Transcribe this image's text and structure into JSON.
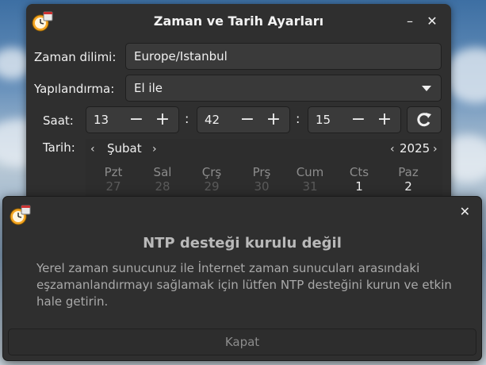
{
  "window": {
    "title": "Zaman ve Tarih Ayarları",
    "minimize_glyph": "–",
    "close_glyph": "✕"
  },
  "timezone": {
    "label": "Zaman dilimi:",
    "value": "Europe/Istanbul"
  },
  "config": {
    "label": "Yapılandırma:",
    "value": "El ile"
  },
  "time": {
    "label": "Saat:",
    "hour": "13",
    "minute": "42",
    "second": "15",
    "separator": ":",
    "minus": "−",
    "plus": "+"
  },
  "date": {
    "label": "Tarih:",
    "month": "Şubat",
    "year": "2025",
    "prev": "‹",
    "next": "›",
    "weekdays": [
      "Pzt",
      "Sal",
      "Çrş",
      "Prş",
      "Cum",
      "Cts",
      "Paz"
    ],
    "first_row": [
      "27",
      "28",
      "29",
      "30",
      "31",
      "1",
      "2"
    ]
  },
  "dialog": {
    "close_glyph": "✕",
    "heading": "NTP desteği kurulu değil",
    "line1": "Yerel zaman sunucunuz ile İnternet zaman sunucuları arasındaki",
    "line2": "eşzamanlandırmayı sağlamak için lütfen NTP desteğini kurun ve etkin",
    "line3": "hale getirin.",
    "button": "Kapat"
  },
  "colors": {
    "window_bg": "#2f2f2f",
    "field_bg": "#3a3a3a",
    "text": "#f0f0f0",
    "dim_text": "#a9a9a9"
  },
  "icons": [
    "clock-calendar-icon",
    "minimize-icon",
    "close-icon",
    "refresh-icon",
    "chevron-left-icon",
    "chevron-right-icon",
    "dropdown-arrow-icon"
  ]
}
